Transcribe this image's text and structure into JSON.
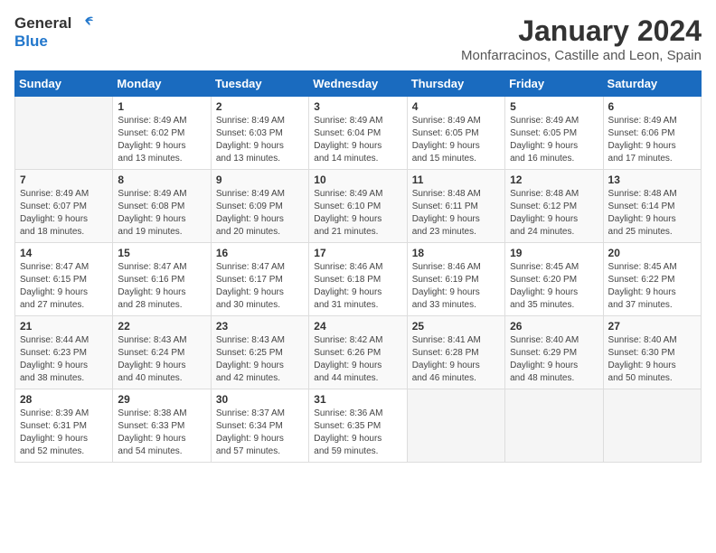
{
  "header": {
    "logo_general": "General",
    "logo_blue": "Blue",
    "month": "January 2024",
    "location": "Monfarracinos, Castille and Leon, Spain"
  },
  "weekdays": [
    "Sunday",
    "Monday",
    "Tuesday",
    "Wednesday",
    "Thursday",
    "Friday",
    "Saturday"
  ],
  "weeks": [
    [
      {
        "day": "",
        "info": ""
      },
      {
        "day": "1",
        "info": "Sunrise: 8:49 AM\nSunset: 6:02 PM\nDaylight: 9 hours\nand 13 minutes."
      },
      {
        "day": "2",
        "info": "Sunrise: 8:49 AM\nSunset: 6:03 PM\nDaylight: 9 hours\nand 13 minutes."
      },
      {
        "day": "3",
        "info": "Sunrise: 8:49 AM\nSunset: 6:04 PM\nDaylight: 9 hours\nand 14 minutes."
      },
      {
        "day": "4",
        "info": "Sunrise: 8:49 AM\nSunset: 6:05 PM\nDaylight: 9 hours\nand 15 minutes."
      },
      {
        "day": "5",
        "info": "Sunrise: 8:49 AM\nSunset: 6:05 PM\nDaylight: 9 hours\nand 16 minutes."
      },
      {
        "day": "6",
        "info": "Sunrise: 8:49 AM\nSunset: 6:06 PM\nDaylight: 9 hours\nand 17 minutes."
      }
    ],
    [
      {
        "day": "7",
        "info": "Sunrise: 8:49 AM\nSunset: 6:07 PM\nDaylight: 9 hours\nand 18 minutes."
      },
      {
        "day": "8",
        "info": "Sunrise: 8:49 AM\nSunset: 6:08 PM\nDaylight: 9 hours\nand 19 minutes."
      },
      {
        "day": "9",
        "info": "Sunrise: 8:49 AM\nSunset: 6:09 PM\nDaylight: 9 hours\nand 20 minutes."
      },
      {
        "day": "10",
        "info": "Sunrise: 8:49 AM\nSunset: 6:10 PM\nDaylight: 9 hours\nand 21 minutes."
      },
      {
        "day": "11",
        "info": "Sunrise: 8:48 AM\nSunset: 6:11 PM\nDaylight: 9 hours\nand 23 minutes."
      },
      {
        "day": "12",
        "info": "Sunrise: 8:48 AM\nSunset: 6:12 PM\nDaylight: 9 hours\nand 24 minutes."
      },
      {
        "day": "13",
        "info": "Sunrise: 8:48 AM\nSunset: 6:14 PM\nDaylight: 9 hours\nand 25 minutes."
      }
    ],
    [
      {
        "day": "14",
        "info": "Sunrise: 8:47 AM\nSunset: 6:15 PM\nDaylight: 9 hours\nand 27 minutes."
      },
      {
        "day": "15",
        "info": "Sunrise: 8:47 AM\nSunset: 6:16 PM\nDaylight: 9 hours\nand 28 minutes."
      },
      {
        "day": "16",
        "info": "Sunrise: 8:47 AM\nSunset: 6:17 PM\nDaylight: 9 hours\nand 30 minutes."
      },
      {
        "day": "17",
        "info": "Sunrise: 8:46 AM\nSunset: 6:18 PM\nDaylight: 9 hours\nand 31 minutes."
      },
      {
        "day": "18",
        "info": "Sunrise: 8:46 AM\nSunset: 6:19 PM\nDaylight: 9 hours\nand 33 minutes."
      },
      {
        "day": "19",
        "info": "Sunrise: 8:45 AM\nSunset: 6:20 PM\nDaylight: 9 hours\nand 35 minutes."
      },
      {
        "day": "20",
        "info": "Sunrise: 8:45 AM\nSunset: 6:22 PM\nDaylight: 9 hours\nand 37 minutes."
      }
    ],
    [
      {
        "day": "21",
        "info": "Sunrise: 8:44 AM\nSunset: 6:23 PM\nDaylight: 9 hours\nand 38 minutes."
      },
      {
        "day": "22",
        "info": "Sunrise: 8:43 AM\nSunset: 6:24 PM\nDaylight: 9 hours\nand 40 minutes."
      },
      {
        "day": "23",
        "info": "Sunrise: 8:43 AM\nSunset: 6:25 PM\nDaylight: 9 hours\nand 42 minutes."
      },
      {
        "day": "24",
        "info": "Sunrise: 8:42 AM\nSunset: 6:26 PM\nDaylight: 9 hours\nand 44 minutes."
      },
      {
        "day": "25",
        "info": "Sunrise: 8:41 AM\nSunset: 6:28 PM\nDaylight: 9 hours\nand 46 minutes."
      },
      {
        "day": "26",
        "info": "Sunrise: 8:40 AM\nSunset: 6:29 PM\nDaylight: 9 hours\nand 48 minutes."
      },
      {
        "day": "27",
        "info": "Sunrise: 8:40 AM\nSunset: 6:30 PM\nDaylight: 9 hours\nand 50 minutes."
      }
    ],
    [
      {
        "day": "28",
        "info": "Sunrise: 8:39 AM\nSunset: 6:31 PM\nDaylight: 9 hours\nand 52 minutes."
      },
      {
        "day": "29",
        "info": "Sunrise: 8:38 AM\nSunset: 6:33 PM\nDaylight: 9 hours\nand 54 minutes."
      },
      {
        "day": "30",
        "info": "Sunrise: 8:37 AM\nSunset: 6:34 PM\nDaylight: 9 hours\nand 57 minutes."
      },
      {
        "day": "31",
        "info": "Sunrise: 8:36 AM\nSunset: 6:35 PM\nDaylight: 9 hours\nand 59 minutes."
      },
      {
        "day": "",
        "info": ""
      },
      {
        "day": "",
        "info": ""
      },
      {
        "day": "",
        "info": ""
      }
    ]
  ]
}
